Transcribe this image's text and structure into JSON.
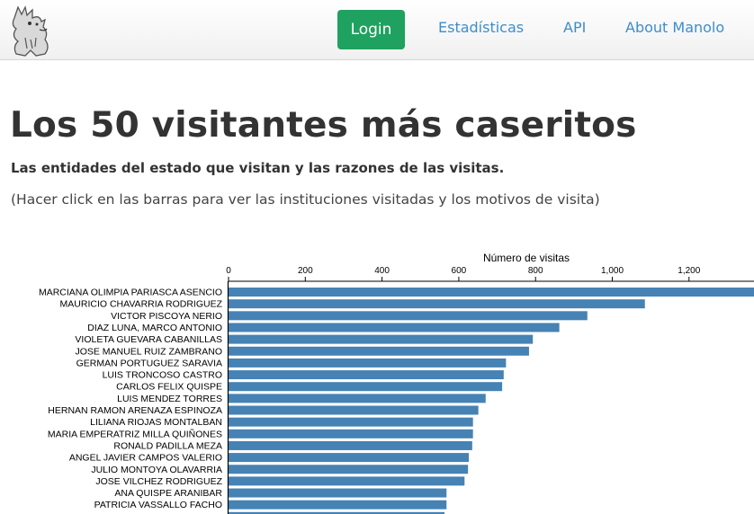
{
  "navbar": {
    "login_label": "Login",
    "links": [
      "Estadísticas",
      "API",
      "About Manolo"
    ],
    "link_color": "#3d8ecb",
    "login_color": "#1fa15f"
  },
  "header": {
    "title": "Los 50 visitantes más caseritos",
    "subtitle": "Las entidades del estado que visitan y las razones de las visitas.",
    "hint": "(Hacer click en las barras para ver las instituciones visitadas y los motivos de visita)"
  },
  "chart_data": {
    "type": "bar",
    "orientation": "horizontal",
    "xlabel": "Número de visitas",
    "axis_position": "top",
    "xlim": [
      0,
      1370
    ],
    "xticks": [
      0,
      200,
      400,
      600,
      800,
      1000,
      1200
    ],
    "xtick_labels": [
      "0",
      "200",
      "400",
      "600",
      "800",
      "1,000",
      "1,200"
    ],
    "bar_color": "#4682b4",
    "categories": [
      "MARCIANA OLIMPIA PARIASCA ASENCIO",
      "MAURICIO CHAVARRIA RODRIGUEZ",
      "VICTOR PISCOYA NERIO",
      "DIAZ LUNA, MARCO ANTONIO",
      "VIOLETA GUEVARA CABANILLAS",
      "JOSE MANUEL RUIZ ZAMBRANO",
      "GERMAN PORTUGUEZ SARAVIA",
      "LUIS TRONCOSO CASTRO",
      "CARLOS FELIX QUISPE",
      "LUIS MENDEZ TORRES",
      "HERNAN RAMON ARENAZA ESPINOZA",
      "LILIANA RIOJAS MONTALBAN",
      "MARIA EMPERATRIZ MILLA QUIÑONES",
      "RONALD PADILLA MEZA",
      "ANGEL JAVIER CAMPOS VALERIO",
      "JULIO MONTOYA OLAVARRIA",
      "JOSE VILCHEZ RODRIGUEZ",
      "ANA QUISPE ARANIBAR",
      "PATRICIA VASSALLO FACHO"
    ],
    "values": [
      1380,
      1085,
      935,
      862,
      793,
      783,
      723,
      717,
      713,
      670,
      651,
      637,
      637,
      635,
      626,
      624,
      615,
      568,
      568
    ]
  }
}
